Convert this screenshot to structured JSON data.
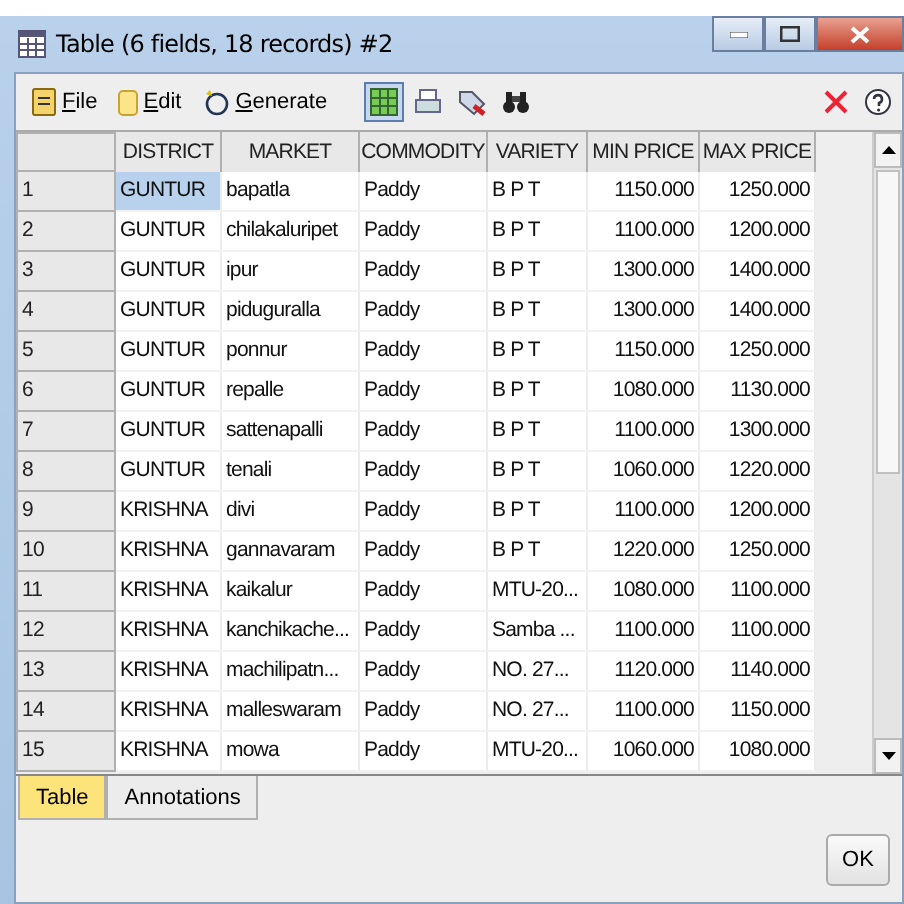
{
  "window": {
    "title": "Table (6 fields, 18 records) #2"
  },
  "menu": [
    {
      "label": "File",
      "kind": "file"
    },
    {
      "label": "Edit",
      "kind": "edit"
    },
    {
      "label": "Generate",
      "kind": "generate"
    }
  ],
  "toolbar": [
    {
      "kind": "grid",
      "selected": true
    },
    {
      "kind": "print",
      "selected": false
    },
    {
      "kind": "export",
      "selected": false
    },
    {
      "kind": "find",
      "selected": false
    }
  ],
  "table": {
    "columns": [
      "DISTRICT",
      "MARKET",
      "COMMODITY",
      "VARIETY",
      "MIN PRICE",
      "MAX PRICE"
    ],
    "rows": [
      {
        "index": "1",
        "cells": [
          "GUNTUR",
          "bapatla",
          "Paddy",
          "B P T",
          "1150.000",
          "1250.000"
        ],
        "selected": true
      },
      {
        "index": "2",
        "cells": [
          "GUNTUR",
          "chilakaluripet",
          "Paddy",
          "B P T",
          "1100.000",
          "1200.000"
        ],
        "selected": false
      },
      {
        "index": "3",
        "cells": [
          "GUNTUR",
          "ipur",
          "Paddy",
          "B P T",
          "1300.000",
          "1400.000"
        ],
        "selected": false
      },
      {
        "index": "4",
        "cells": [
          "GUNTUR",
          "piduguralla",
          "Paddy",
          "B P T",
          "1300.000",
          "1400.000"
        ],
        "selected": false
      },
      {
        "index": "5",
        "cells": [
          "GUNTUR",
          "ponnur",
          "Paddy",
          "B P T",
          "1150.000",
          "1250.000"
        ],
        "selected": false
      },
      {
        "index": "6",
        "cells": [
          "GUNTUR",
          "repalle",
          "Paddy",
          "B P T",
          "1080.000",
          "1130.000"
        ],
        "selected": false
      },
      {
        "index": "7",
        "cells": [
          "GUNTUR",
          "sattenapalli",
          "Paddy",
          "B P T",
          "1100.000",
          "1300.000"
        ],
        "selected": false
      },
      {
        "index": "8",
        "cells": [
          "GUNTUR",
          "tenali",
          "Paddy",
          "B P T",
          "1060.000",
          "1220.000"
        ],
        "selected": false
      },
      {
        "index": "9",
        "cells": [
          "KRISHNA",
          "divi",
          "Paddy",
          "B P T",
          "1100.000",
          "1200.000"
        ],
        "selected": false
      },
      {
        "index": "10",
        "cells": [
          "KRISHNA",
          "gannavaram",
          "Paddy",
          "B P T",
          "1220.000",
          "1250.000"
        ],
        "selected": false
      },
      {
        "index": "11",
        "cells": [
          "KRISHNA",
          "kaikalur",
          "Paddy",
          "MTU-20...",
          "1080.000",
          "1100.000"
        ],
        "selected": false
      },
      {
        "index": "12",
        "cells": [
          "KRISHNA",
          "kanchikache...",
          "Paddy",
          "Samba ...",
          "1100.000",
          "1100.000"
        ],
        "selected": false
      },
      {
        "index": "13",
        "cells": [
          "KRISHNA",
          "machilipatn...",
          "Paddy",
          "NO. 27...",
          "1120.000",
          "1140.000"
        ],
        "selected": false
      },
      {
        "index": "14",
        "cells": [
          "KRISHNA",
          "malleswaram",
          "Paddy",
          "NO. 27...",
          "1100.000",
          "1150.000"
        ],
        "selected": false
      },
      {
        "index": "15",
        "cells": [
          "KRISHNA",
          "mowa",
          "Paddy",
          "MTU-20...",
          "1060.000",
          "1080.000"
        ],
        "selected": false
      }
    ]
  },
  "tabs": [
    {
      "label": "Table",
      "selected": true
    },
    {
      "label": "Annotations",
      "selected": false
    }
  ],
  "buttons": [
    "OK"
  ]
}
